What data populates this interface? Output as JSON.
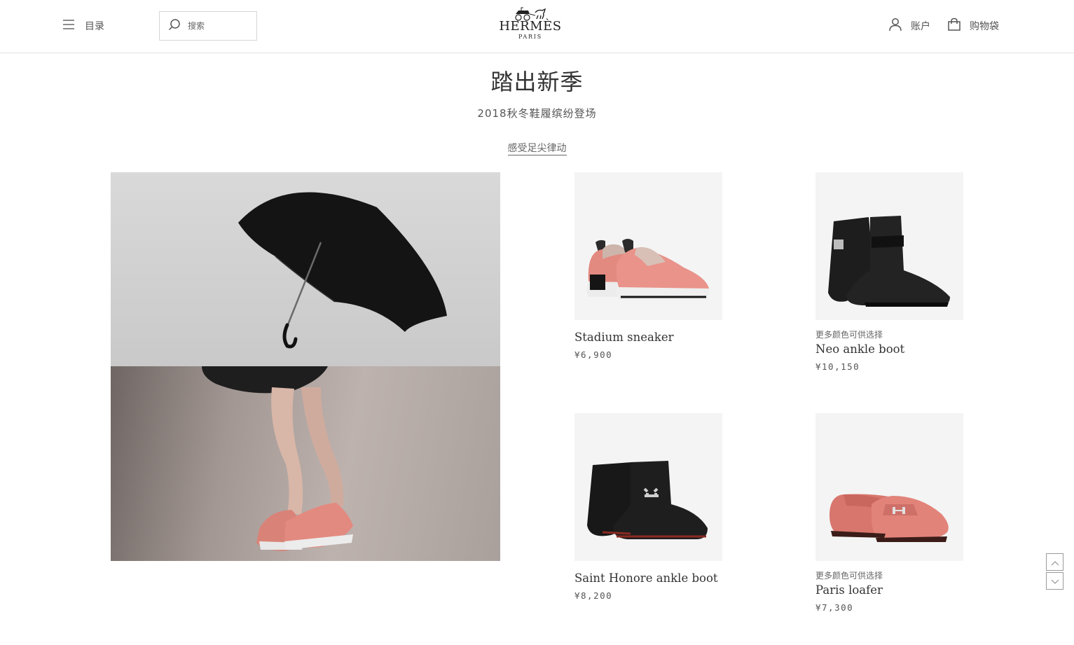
{
  "header": {
    "menu_label": "目录",
    "search_placeholder": "搜索",
    "logo_brand": "HERMÈS",
    "logo_city": "PARIS",
    "account_label": "账户",
    "bag_label": "购物袋"
  },
  "hero": {
    "title": "踏出新季",
    "subtitle": "2018秋冬鞋履缤纷登场",
    "link": "感受足尖律动"
  },
  "products": [
    {
      "name": "Stadium sneaker",
      "price": "¥6,900",
      "more_colors": ""
    },
    {
      "name": "Neo ankle boot",
      "price": "¥10,150",
      "more_colors": "更多颜色可供选择"
    },
    {
      "name": "Saint Honore ankle boot",
      "price": "¥8,200",
      "more_colors": ""
    },
    {
      "name": "Paris loafer",
      "price": "¥7,300",
      "more_colors": "更多颜色可供选择"
    }
  ],
  "icons": {
    "menu": "menu-icon",
    "search": "search-icon",
    "account": "user-icon",
    "bag": "shopping-bag-icon",
    "scroll_up": "chevron-up-icon",
    "scroll_down": "chevron-down-icon"
  },
  "colors": {
    "product_bg": "#f4f4f4",
    "sneaker_pink": "#e8877f",
    "loafer_pink": "#dd7a72",
    "boot_black": "#1c1c1c"
  }
}
